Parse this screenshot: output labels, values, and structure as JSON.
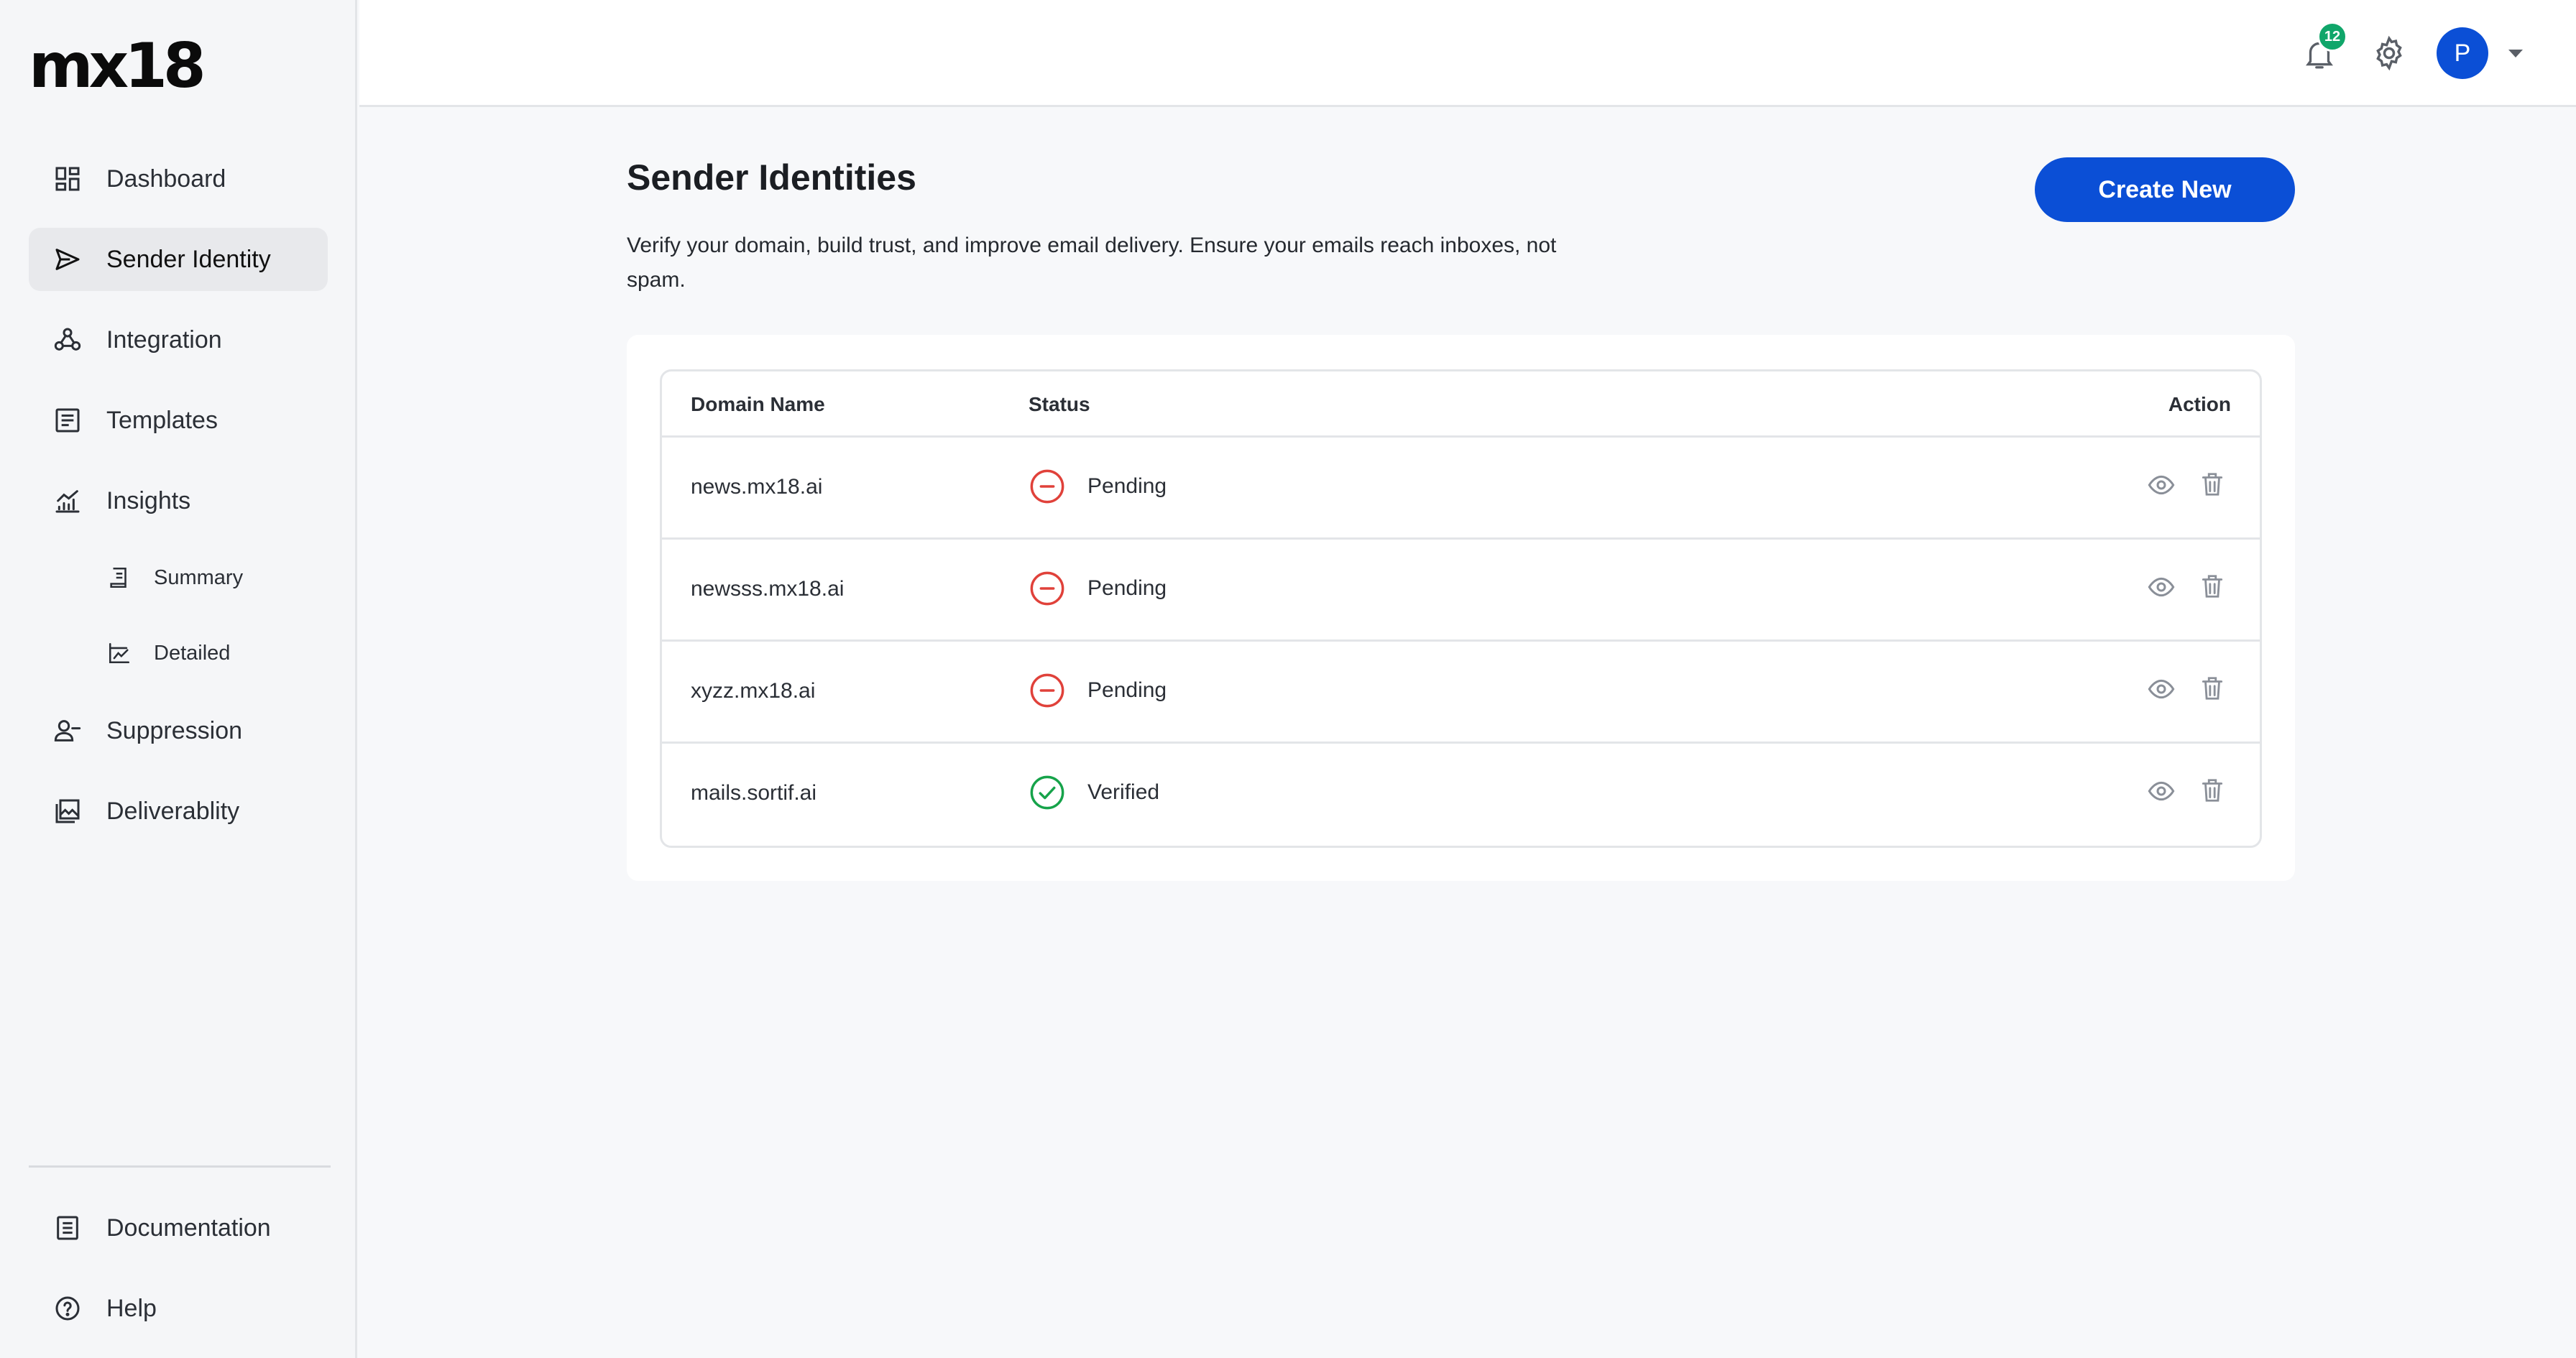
{
  "app": {
    "logo": "mx18"
  },
  "sidebar": {
    "items": [
      {
        "label": "Dashboard",
        "icon": "dashboard-icon"
      },
      {
        "label": "Sender Identity",
        "icon": "send-icon",
        "active": true
      },
      {
        "label": "Integration",
        "icon": "webhook-icon"
      },
      {
        "label": "Templates",
        "icon": "template-icon"
      },
      {
        "label": "Insights",
        "icon": "chart-icon"
      },
      {
        "label": "Summary",
        "icon": "receipt-icon"
      },
      {
        "label": "Detailed",
        "icon": "line-chart-icon"
      },
      {
        "label": "Suppression",
        "icon": "user-minus-icon"
      },
      {
        "label": "Deliverablity",
        "icon": "gallery-icon"
      }
    ],
    "footer": [
      {
        "label": "Documentation",
        "icon": "document-icon"
      },
      {
        "label": "Help",
        "icon": "help-icon"
      }
    ]
  },
  "topbar": {
    "notifications": "12",
    "avatar_initial": "P"
  },
  "main": {
    "title": "Sender Identities",
    "description": "Verify your domain, build trust, and improve email delivery. Ensure your emails reach inboxes, not spam.",
    "create_label": "Create New",
    "table": {
      "headers": {
        "domain": "Domain Name",
        "status": "Status",
        "action": "Action"
      },
      "rows": [
        {
          "domain": "news.mx18.ai",
          "status": "Pending"
        },
        {
          "domain": "newsss.mx18.ai",
          "status": "Pending"
        },
        {
          "domain": "xyzz.mx18.ai",
          "status": "Pending"
        },
        {
          "domain": "mails.sortif.ai",
          "status": "Verified"
        }
      ]
    }
  },
  "colors": {
    "accent": "#0b4fd6",
    "pending": "#e0413a",
    "verified": "#16a34a",
    "badge": "#10a66a"
  }
}
